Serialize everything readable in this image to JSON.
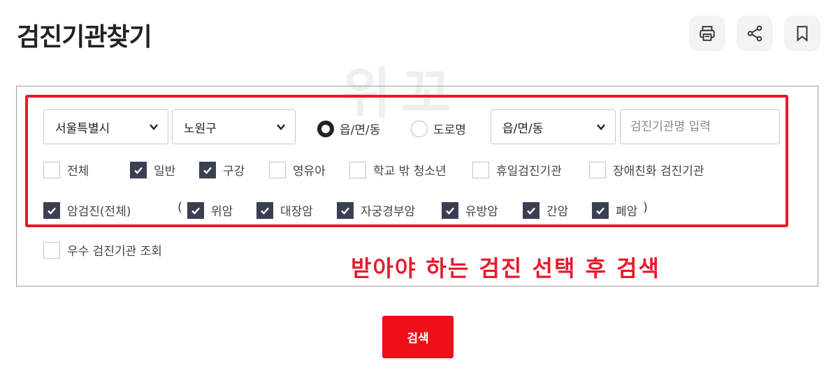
{
  "page": {
    "title": "검진기관찾기"
  },
  "toolbar": {
    "print_icon": "printer-icon",
    "share_icon": "share-icon",
    "bookmark_icon": "bookmark-icon"
  },
  "watermark": {
    "text": "위꼬"
  },
  "filters": {
    "region": {
      "selected": "서울특별시"
    },
    "district": {
      "selected": "노원구"
    },
    "address_type": {
      "options": [
        {
          "label": "읍/면/동",
          "selected": true
        },
        {
          "label": "도로명",
          "selected": false
        }
      ]
    },
    "town": {
      "selected": "읍/면/동"
    },
    "name_input": {
      "placeholder": "검진기관명 입력",
      "value": ""
    }
  },
  "exam_types": [
    {
      "label": "전체",
      "checked": false
    },
    {
      "label": "일반",
      "checked": true
    },
    {
      "label": "구강",
      "checked": true
    },
    {
      "label": "영유아",
      "checked": false
    },
    {
      "label": "학교 밖 청소년",
      "checked": false
    },
    {
      "label": "휴일검진기관",
      "checked": false
    },
    {
      "label": "장애친화 검진기관",
      "checked": false
    }
  ],
  "cancer": {
    "all": {
      "label": "암검진(전체)",
      "checked": true
    },
    "paren_open": "(",
    "paren_close": ")",
    "items": [
      {
        "label": "위암",
        "checked": true
      },
      {
        "label": "대장암",
        "checked": true
      },
      {
        "label": "자궁경부암",
        "checked": true
      },
      {
        "label": "유방암",
        "checked": true
      },
      {
        "label": "간암",
        "checked": true
      },
      {
        "label": "폐암",
        "checked": true
      }
    ]
  },
  "excellent": {
    "label": "우수 검진기관 조회",
    "checked": false
  },
  "annotation": {
    "text": "받아야 하는 검진 선택 후 검색"
  },
  "search_button": {
    "label": "검색"
  },
  "colors": {
    "accent": "#ee0f19",
    "checkbox_on": "#3a3f52",
    "highlight": "#e8192c"
  }
}
